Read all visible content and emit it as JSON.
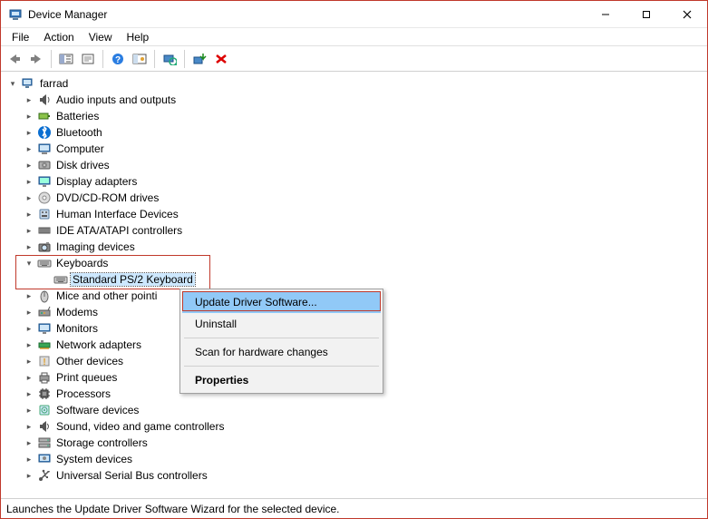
{
  "window": {
    "title": "Device Manager"
  },
  "menu": {
    "items": [
      "File",
      "Action",
      "View",
      "Help"
    ]
  },
  "toolbar": {
    "back": "back-icon",
    "forward": "forward-icon",
    "showhide": "show-hide-console-tree-icon",
    "properties": "properties-icon",
    "help": "help-icon",
    "showhidden": "show-hidden-icon",
    "scan": "scan-hardware-icon",
    "update": "update-driver-icon",
    "uninstall": "uninstall-icon"
  },
  "tree": {
    "root": {
      "label": "farrad",
      "expanded": true
    },
    "items": [
      {
        "label": "Audio inputs and outputs",
        "icon": "audio"
      },
      {
        "label": "Batteries",
        "icon": "battery"
      },
      {
        "label": "Bluetooth",
        "icon": "bluetooth"
      },
      {
        "label": "Computer",
        "icon": "computer"
      },
      {
        "label": "Disk drives",
        "icon": "disk"
      },
      {
        "label": "Display adapters",
        "icon": "display"
      },
      {
        "label": "DVD/CD-ROM drives",
        "icon": "dvd"
      },
      {
        "label": "Human Interface Devices",
        "icon": "hid"
      },
      {
        "label": "IDE ATA/ATAPI controllers",
        "icon": "ide"
      },
      {
        "label": "Imaging devices",
        "icon": "imaging"
      },
      {
        "label": "Keyboards",
        "icon": "keyboard",
        "expanded": true,
        "children": [
          {
            "label": "Standard PS/2 Keyboard",
            "icon": "keyboard",
            "selected": true
          }
        ]
      },
      {
        "label": "Mice and other pointing devices",
        "icon": "mouse",
        "clip": "Mice and other pointi"
      },
      {
        "label": "Modems",
        "icon": "modem"
      },
      {
        "label": "Monitors",
        "icon": "monitor"
      },
      {
        "label": "Network adapters",
        "icon": "network"
      },
      {
        "label": "Other devices",
        "icon": "other"
      },
      {
        "label": "Print queues",
        "icon": "printer"
      },
      {
        "label": "Processors",
        "icon": "processor"
      },
      {
        "label": "Software devices",
        "icon": "software"
      },
      {
        "label": "Sound, video and game controllers",
        "icon": "sound"
      },
      {
        "label": "Storage controllers",
        "icon": "storage"
      },
      {
        "label": "System devices",
        "icon": "system"
      },
      {
        "label": "Universal Serial Bus controllers",
        "icon": "usb"
      }
    ]
  },
  "context_menu": {
    "items": [
      {
        "label": "Update Driver Software...",
        "highlight": true
      },
      {
        "label": "Uninstall"
      },
      {
        "sep": true
      },
      {
        "label": "Scan for hardware changes"
      },
      {
        "sep": true
      },
      {
        "label": "Properties",
        "bold": true
      }
    ]
  },
  "status": {
    "text": "Launches the Update Driver Software Wizard for the selected device."
  }
}
